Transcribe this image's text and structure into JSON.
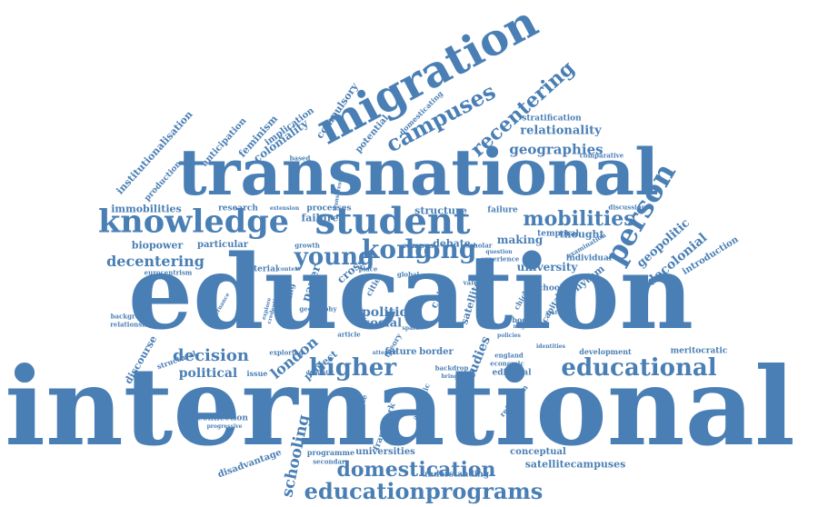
{
  "colors": {
    "word": "#4a7fb5",
    "background": "#ffffff"
  },
  "words": [
    "international",
    "education",
    "transnational",
    "migration",
    "student",
    "knowledge",
    "kong",
    "hong",
    "young",
    "person",
    "higher",
    "educational",
    "educationprograms",
    "campuses",
    "recentering",
    "mobilities",
    "domestication",
    "geographies",
    "relationality",
    "decentering",
    "biopower",
    "immobilities",
    "institutionalisation",
    "anticipation",
    "feminism",
    "coloniality",
    "implication",
    "compulsory",
    "potential",
    "domesticating",
    "stratification",
    "comparative",
    "geopolitic",
    "decolonial",
    "introduction",
    "thought",
    "making",
    "temporal",
    "individual",
    "rhythm",
    "university",
    "school",
    "satellite",
    "politic",
    "social",
    "paper",
    "cross",
    "cities",
    "child",
    "way",
    "value",
    "decision",
    "political",
    "london",
    "project",
    "studies",
    "future",
    "border",
    "structural",
    "discourse",
    "schooling",
    "editorial",
    "development",
    "meritocratic",
    "england",
    "economic",
    "identities",
    "reflection",
    "conceptual",
    "satellitecampuses",
    "understanding",
    "universities",
    "programme",
    "secondary",
    "disadvantage",
    "connection",
    "progressive",
    "background",
    "relationship",
    "governance",
    "eurocentrism",
    "particular",
    "growth",
    "material",
    "context",
    "research",
    "extension",
    "processes",
    "failure",
    "structure",
    "debate",
    "scholar",
    "campus",
    "place",
    "global",
    "failure",
    "discussion",
    "examination",
    "experience",
    "question",
    "chicken",
    "capital",
    "bodies",
    "system",
    "migrant",
    "policies",
    "space",
    "article",
    "attempt",
    "theory",
    "issue",
    "exploring",
    "domestic",
    "example",
    "framework",
    "academic",
    "bringing",
    "backdrop",
    "explore",
    "credential",
    "signalling",
    "geography",
    "based",
    "production",
    "transgressive",
    "scale"
  ]
}
